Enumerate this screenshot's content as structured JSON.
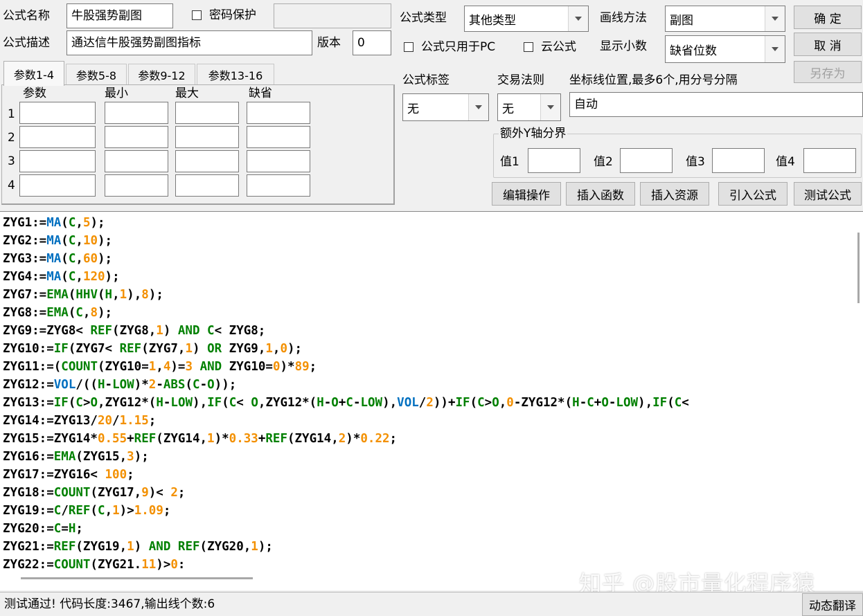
{
  "top": {
    "name_label": "公式名称",
    "name_value": "牛股强势副图",
    "password_label": "密码保护",
    "password_value": "",
    "desc_label": "公式描述",
    "desc_value": "通达信牛股强势副图指标",
    "version_label": "版本",
    "version_value": "0",
    "type_label": "公式类型",
    "type_value": "其他类型",
    "draw_label": "画线方法",
    "draw_value": "副图",
    "pc_only_label": "公式只用于PC",
    "cloud_label": "云公式",
    "decimals_label": "显示小数",
    "decimals_value": "缺省位数"
  },
  "buttons": {
    "ok": "确 定",
    "cancel": "取 消",
    "save_as": "另存为",
    "edit": "编辑操作",
    "insert_func": "插入函数",
    "insert_res": "插入资源",
    "import": "引入公式",
    "test": "测试公式",
    "translate": "动态翻译"
  },
  "tabs": [
    "参数1-4",
    "参数5-8",
    "参数9-12",
    "参数13-16"
  ],
  "params": {
    "headers": [
      "参数",
      "最小",
      "最大",
      "缺省"
    ],
    "rows": [
      "1",
      "2",
      "3",
      "4"
    ]
  },
  "right": {
    "tag_label": "公式标签",
    "tag_value": "无",
    "rule_label": "交易法则",
    "rule_value": "无",
    "coord_label": "坐标线位置,最多6个,用分号分隔",
    "coord_value": "自动",
    "yaxis_group": "额外Y轴分界",
    "v1": "值1",
    "v2": "值2",
    "v3": "值3",
    "v4": "值4"
  },
  "code_lines": [
    [
      [
        "ZYG1:=",
        "n"
      ],
      [
        "MA",
        "b"
      ],
      [
        "(",
        "n"
      ],
      [
        "C",
        "f"
      ],
      [
        ",",
        "n"
      ],
      [
        "5",
        "o"
      ],
      [
        ");",
        "n"
      ]
    ],
    [
      [
        "ZYG2:=",
        "n"
      ],
      [
        "MA",
        "b"
      ],
      [
        "(",
        "n"
      ],
      [
        "C",
        "f"
      ],
      [
        ",",
        "n"
      ],
      [
        "10",
        "o"
      ],
      [
        ");",
        "n"
      ]
    ],
    [
      [
        "ZYG3:=",
        "n"
      ],
      [
        "MA",
        "b"
      ],
      [
        "(",
        "n"
      ],
      [
        "C",
        "f"
      ],
      [
        ",",
        "n"
      ],
      [
        "60",
        "o"
      ],
      [
        ");",
        "n"
      ]
    ],
    [
      [
        "ZYG4:=",
        "n"
      ],
      [
        "MA",
        "b"
      ],
      [
        "(",
        "n"
      ],
      [
        "C",
        "f"
      ],
      [
        ",",
        "n"
      ],
      [
        "120",
        "o"
      ],
      [
        ");",
        "n"
      ]
    ],
    [
      [
        "ZYG7:=",
        "n"
      ],
      [
        "EMA",
        "f"
      ],
      [
        "(",
        "n"
      ],
      [
        "HHV",
        "f"
      ],
      [
        "(",
        "n"
      ],
      [
        "H",
        "f"
      ],
      [
        ",",
        "n"
      ],
      [
        "1",
        "o"
      ],
      [
        "),",
        "n"
      ],
      [
        "8",
        "o"
      ],
      [
        ");",
        "n"
      ]
    ],
    [
      [
        "ZYG8:=",
        "n"
      ],
      [
        "EMA",
        "f"
      ],
      [
        "(",
        "n"
      ],
      [
        "C",
        "f"
      ],
      [
        ",",
        "n"
      ],
      [
        "8",
        "o"
      ],
      [
        ");",
        "n"
      ]
    ],
    [
      [
        "ZYG9:=ZYG8< ",
        "n"
      ],
      [
        "REF",
        "f"
      ],
      [
        "(ZYG8,",
        "n"
      ],
      [
        "1",
        "o"
      ],
      [
        ") ",
        "n"
      ],
      [
        "AND",
        "f"
      ],
      [
        " ",
        "n"
      ],
      [
        "C",
        "f"
      ],
      [
        "< ZYG8;",
        "n"
      ]
    ],
    [
      [
        "ZYG10:=",
        "n"
      ],
      [
        "IF",
        "f"
      ],
      [
        "(ZYG7< ",
        "n"
      ],
      [
        "REF",
        "f"
      ],
      [
        "(ZYG7,",
        "n"
      ],
      [
        "1",
        "o"
      ],
      [
        ") ",
        "n"
      ],
      [
        "OR",
        "f"
      ],
      [
        " ZYG9,",
        "n"
      ],
      [
        "1",
        "o"
      ],
      [
        ",",
        "n"
      ],
      [
        "0",
        "o"
      ],
      [
        ");",
        "n"
      ]
    ],
    [
      [
        "ZYG11:=(",
        "n"
      ],
      [
        "COUNT",
        "f"
      ],
      [
        "(ZYG10=",
        "n"
      ],
      [
        "1",
        "o"
      ],
      [
        ",",
        "n"
      ],
      [
        "4",
        "o"
      ],
      [
        ")=",
        "n"
      ],
      [
        "3",
        "o"
      ],
      [
        " ",
        "n"
      ],
      [
        "AND",
        "f"
      ],
      [
        " ZYG10=",
        "n"
      ],
      [
        "0",
        "o"
      ],
      [
        ")*",
        "n"
      ],
      [
        "89",
        "o"
      ],
      [
        ";",
        "n"
      ]
    ],
    [
      [
        "ZYG12:=",
        "n"
      ],
      [
        "VOL",
        "b"
      ],
      [
        "/((",
        "n"
      ],
      [
        "H",
        "f"
      ],
      [
        "-",
        "n"
      ],
      [
        "LOW",
        "f"
      ],
      [
        ")*",
        "n"
      ],
      [
        "2",
        "o"
      ],
      [
        "-",
        "n"
      ],
      [
        "ABS",
        "f"
      ],
      [
        "(",
        "n"
      ],
      [
        "C",
        "f"
      ],
      [
        "-",
        "n"
      ],
      [
        "O",
        "f"
      ],
      [
        "));",
        "n"
      ]
    ],
    [
      [
        "ZYG13:=",
        "n"
      ],
      [
        "IF",
        "f"
      ],
      [
        "(",
        "n"
      ],
      [
        "C",
        "f"
      ],
      [
        ">",
        "n"
      ],
      [
        "O",
        "f"
      ],
      [
        ",ZYG12*(",
        "n"
      ],
      [
        "H",
        "f"
      ],
      [
        "-",
        "n"
      ],
      [
        "LOW",
        "f"
      ],
      [
        "),",
        "n"
      ],
      [
        "IF",
        "f"
      ],
      [
        "(",
        "n"
      ],
      [
        "C",
        "f"
      ],
      [
        "< ",
        "n"
      ],
      [
        "O",
        "f"
      ],
      [
        ",ZYG12*(",
        "n"
      ],
      [
        "H",
        "f"
      ],
      [
        "-",
        "n"
      ],
      [
        "O",
        "f"
      ],
      [
        "+",
        "n"
      ],
      [
        "C",
        "f"
      ],
      [
        "-",
        "n"
      ],
      [
        "LOW",
        "f"
      ],
      [
        "),",
        "n"
      ],
      [
        "VOL",
        "b"
      ],
      [
        "/",
        "n"
      ],
      [
        "2",
        "o"
      ],
      [
        "))+",
        "n"
      ],
      [
        "IF",
        "f"
      ],
      [
        "(",
        "n"
      ],
      [
        "C",
        "f"
      ],
      [
        ">",
        "n"
      ],
      [
        "O",
        "f"
      ],
      [
        ",",
        "n"
      ],
      [
        "0",
        "o"
      ],
      [
        "-ZYG12*(",
        "n"
      ],
      [
        "H",
        "f"
      ],
      [
        "-",
        "n"
      ],
      [
        "C",
        "f"
      ],
      [
        "+",
        "n"
      ],
      [
        "O",
        "f"
      ],
      [
        "-",
        "n"
      ],
      [
        "LOW",
        "f"
      ],
      [
        "),",
        "n"
      ],
      [
        "IF",
        "f"
      ],
      [
        "(",
        "n"
      ],
      [
        "C",
        "f"
      ],
      [
        "<",
        "n"
      ]
    ],
    [
      [
        "ZYG14:=ZYG13/",
        "n"
      ],
      [
        "20",
        "o"
      ],
      [
        "/",
        "n"
      ],
      [
        "1.15",
        "o"
      ],
      [
        ";",
        "n"
      ]
    ],
    [
      [
        "ZYG15:=ZYG14*",
        "n"
      ],
      [
        "0.55",
        "o"
      ],
      [
        "+",
        "n"
      ],
      [
        "REF",
        "f"
      ],
      [
        "(ZYG14,",
        "n"
      ],
      [
        "1",
        "o"
      ],
      [
        ")*",
        "n"
      ],
      [
        "0.33",
        "o"
      ],
      [
        "+",
        "n"
      ],
      [
        "REF",
        "f"
      ],
      [
        "(ZYG14,",
        "n"
      ],
      [
        "2",
        "o"
      ],
      [
        ")*",
        "n"
      ],
      [
        "0.22",
        "o"
      ],
      [
        ";",
        "n"
      ]
    ],
    [
      [
        "ZYG16:=",
        "n"
      ],
      [
        "EMA",
        "f"
      ],
      [
        "(ZYG15,",
        "n"
      ],
      [
        "3",
        "o"
      ],
      [
        ");",
        "n"
      ]
    ],
    [
      [
        "ZYG17:=ZYG16< ",
        "n"
      ],
      [
        "100",
        "o"
      ],
      [
        ";",
        "n"
      ]
    ],
    [
      [
        "ZYG18:=",
        "n"
      ],
      [
        "COUNT",
        "f"
      ],
      [
        "(ZYG17,",
        "n"
      ],
      [
        "9",
        "o"
      ],
      [
        ")< ",
        "n"
      ],
      [
        "2",
        "o"
      ],
      [
        ";",
        "n"
      ]
    ],
    [
      [
        "ZYG19:=",
        "n"
      ],
      [
        "C",
        "f"
      ],
      [
        "/",
        "n"
      ],
      [
        "REF",
        "f"
      ],
      [
        "(",
        "n"
      ],
      [
        "C",
        "f"
      ],
      [
        ",",
        "n"
      ],
      [
        "1",
        "o"
      ],
      [
        ")>",
        "n"
      ],
      [
        "1.09",
        "o"
      ],
      [
        ";",
        "n"
      ]
    ],
    [
      [
        "ZYG20:=",
        "n"
      ],
      [
        "C",
        "f"
      ],
      [
        "=",
        "n"
      ],
      [
        "H",
        "f"
      ],
      [
        ";",
        "n"
      ]
    ],
    [
      [
        "ZYG21:=",
        "n"
      ],
      [
        "REF",
        "f"
      ],
      [
        "(ZYG19,",
        "n"
      ],
      [
        "1",
        "o"
      ],
      [
        ") ",
        "n"
      ],
      [
        "AND",
        "f"
      ],
      [
        " ",
        "n"
      ],
      [
        "REF",
        "f"
      ],
      [
        "(ZYG20,",
        "n"
      ],
      [
        "1",
        "o"
      ],
      [
        ");",
        "n"
      ]
    ],
    [
      [
        "ZYG22:=",
        "n"
      ],
      [
        "COUNT",
        "f"
      ],
      [
        "(ZYG21.",
        "n"
      ],
      [
        "11",
        "o"
      ],
      [
        ")>",
        "n"
      ],
      [
        "0",
        "o"
      ],
      [
        ":",
        "n"
      ]
    ]
  ],
  "watermark": "知乎 @股市量化程序猿",
  "status_text": "测试通过! 代码长度:3467,输出线个数:6"
}
